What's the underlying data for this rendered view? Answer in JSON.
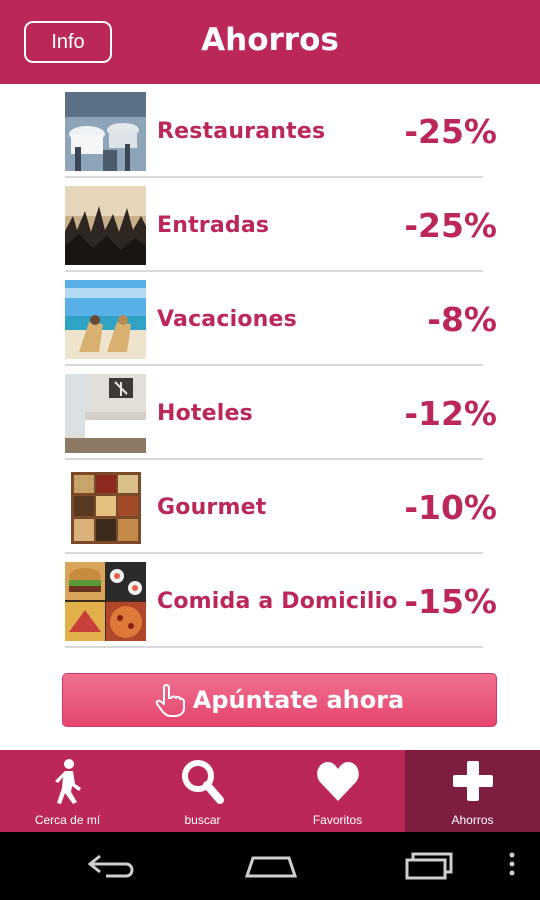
{
  "header": {
    "info_label": "Info",
    "title": "Ahorros"
  },
  "colors": {
    "brand": "#bb2858",
    "active_tab": "#7d1d3f",
    "cta": "#e85276"
  },
  "savings": [
    {
      "label": "Restaurantes",
      "discount": "-25%",
      "image": "restaurant-photo"
    },
    {
      "label": "Entradas",
      "discount": "-25%",
      "image": "concert-crowd-photo"
    },
    {
      "label": "Vacaciones",
      "discount": "-8%",
      "image": "beach-chairs-photo"
    },
    {
      "label": "Hoteles",
      "discount": "-12%",
      "image": "hotel-room-photo"
    },
    {
      "label": "Gourmet",
      "discount": "-10%",
      "image": "gourmet-products-photo"
    },
    {
      "label": "Comida a Domicilio",
      "discount": "-15%",
      "image": "food-collage-photo"
    }
  ],
  "cta": {
    "label": "Apúntate ahora",
    "icon": "hand-pointer-icon"
  },
  "nav": [
    {
      "label": "Cerca de mí",
      "icon": "walking-person-icon"
    },
    {
      "label": "buscar",
      "icon": "magnifier-icon"
    },
    {
      "label": "Favoritos",
      "icon": "heart-icon"
    },
    {
      "label": "Ahorros",
      "icon": "plus-icon",
      "active": true
    }
  ],
  "system_bar": [
    "back-icon",
    "home-icon",
    "recents-icon",
    "overflow-menu-icon"
  ]
}
